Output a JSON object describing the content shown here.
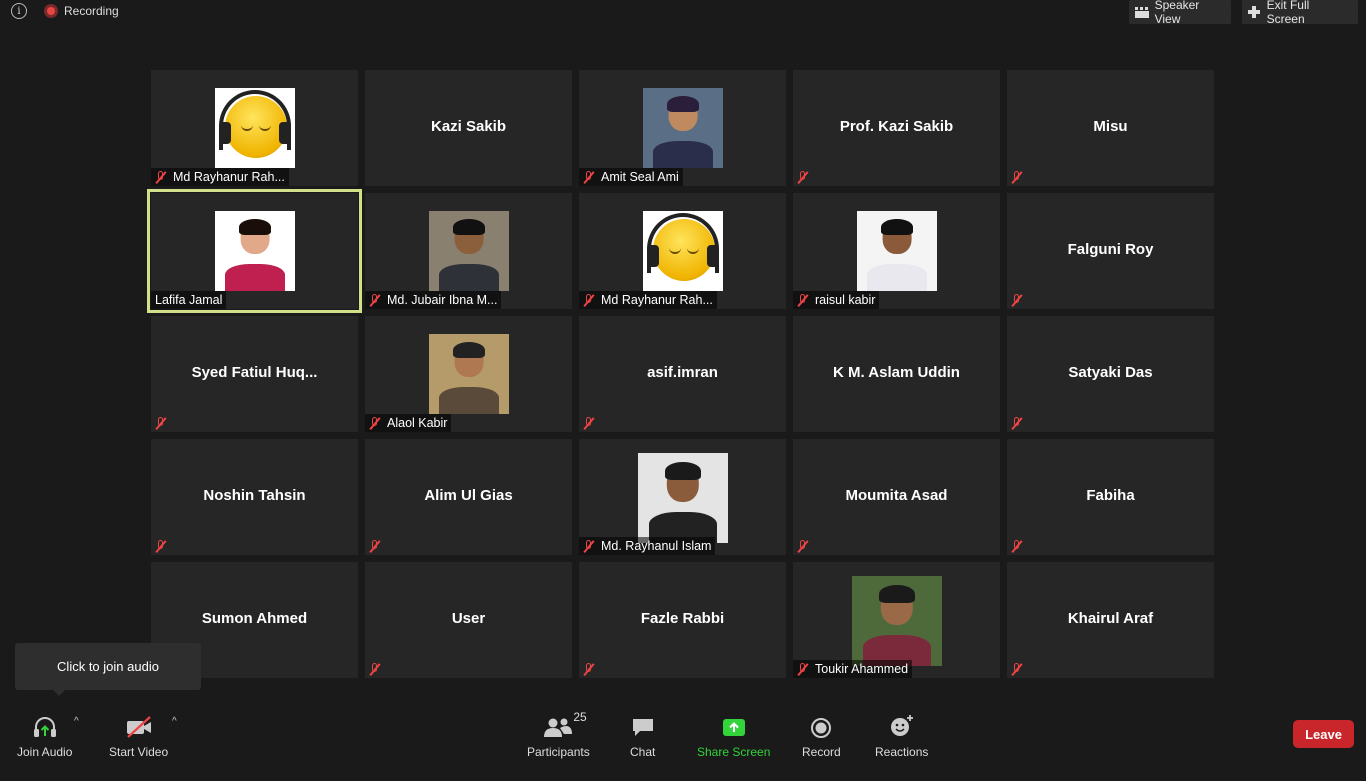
{
  "top": {
    "recording": "Recording",
    "speaker_view": "Speaker View",
    "exit_full_screen": "Exit Full Screen"
  },
  "tiles": [
    {
      "name": "Md Rayhanur Rah...",
      "avatar": "emoji-headphones",
      "muted": true
    },
    {
      "name": "Kazi Sakib",
      "muted": false
    },
    {
      "name": "Amit Seal Ami",
      "avatar": "photo",
      "muted": true
    },
    {
      "name": "Prof. Kazi Sakib",
      "muted": true
    },
    {
      "name": "Misu",
      "muted": true
    },
    {
      "name": "Lafifa Jamal",
      "avatar": "photo",
      "muted": false,
      "active": true
    },
    {
      "name": "Md. Jubair Ibna M...",
      "avatar": "photo",
      "muted": true
    },
    {
      "name": "Md Rayhanur Rah...",
      "avatar": "emoji-headphones",
      "muted": true
    },
    {
      "name": "raisul kabir",
      "avatar": "photo",
      "muted": true
    },
    {
      "name": "Falguni Roy",
      "muted": true
    },
    {
      "name": "Syed  Fatiul  Huq...",
      "muted": true
    },
    {
      "name": "Alaol Kabir",
      "avatar": "photo",
      "muted": true
    },
    {
      "name": "asif.imran",
      "muted": true
    },
    {
      "name": "K M. Aslam Uddin",
      "muted": false
    },
    {
      "name": "Satyaki Das",
      "muted": true
    },
    {
      "name": "Noshin Tahsin",
      "muted": true
    },
    {
      "name": "Alim Ul Gias",
      "muted": true
    },
    {
      "name": "Md. Rayhanul Islam",
      "avatar": "photo",
      "muted": true
    },
    {
      "name": "Moumita Asad",
      "muted": true
    },
    {
      "name": "Fabiha",
      "muted": true
    },
    {
      "name": "Sumon Ahmed",
      "muted": false
    },
    {
      "name": "User",
      "muted": true
    },
    {
      "name": "Fazle Rabbi",
      "muted": true
    },
    {
      "name": "Toukir Ahammed",
      "avatar": "photo",
      "muted": true
    },
    {
      "name": "Khairul Araf",
      "muted": true
    }
  ],
  "tooltip": "Click to join audio",
  "toolbar": {
    "join_audio": "Join Audio",
    "start_video": "Start Video",
    "participants": "Participants",
    "participants_count": "25",
    "chat": "Chat",
    "share_screen": "Share Screen",
    "record": "Record",
    "reactions": "Reactions",
    "leave": "Leave"
  },
  "colors": {
    "active_speaker_border": "#d4e089",
    "share_green": "#33d33b",
    "leave_red": "#c8262a",
    "muted_red": "#e44444"
  }
}
